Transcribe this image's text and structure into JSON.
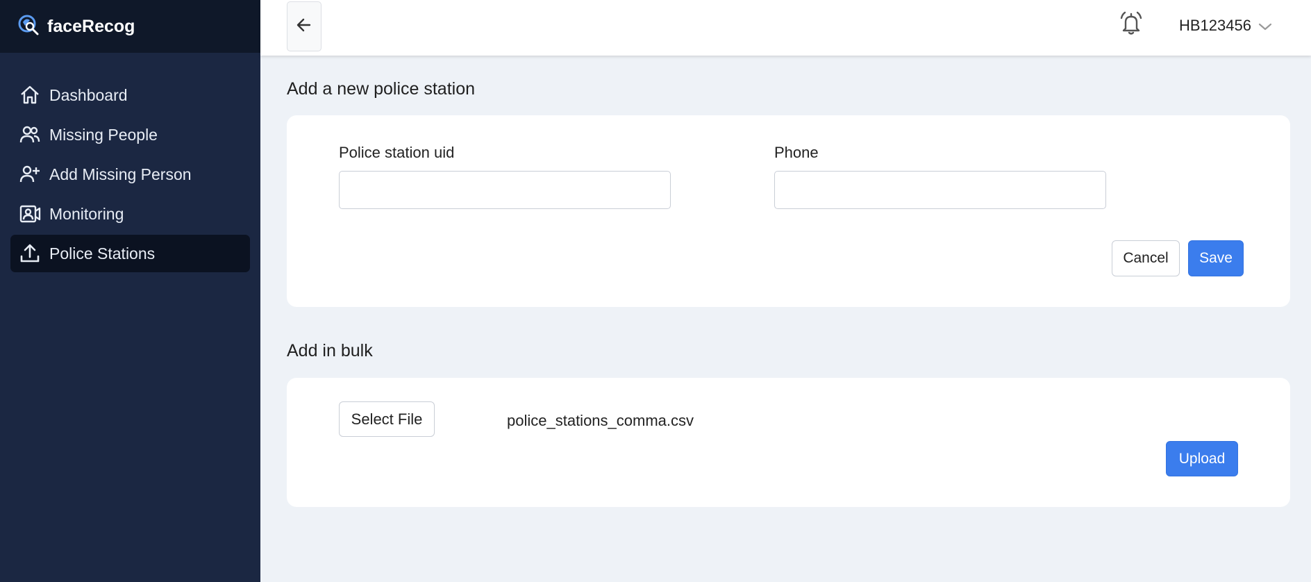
{
  "app": {
    "name": "faceRecog"
  },
  "sidebar": {
    "items": [
      {
        "label": "Dashboard",
        "icon": "home-icon"
      },
      {
        "label": "Missing People",
        "icon": "people-icon"
      },
      {
        "label": "Add Missing Person",
        "icon": "person-add-icon"
      },
      {
        "label": "Monitoring",
        "icon": "video-contact-icon"
      },
      {
        "label": "Police Stations",
        "icon": "upload-icon",
        "active": true
      }
    ]
  },
  "header": {
    "user_id": "HB123456"
  },
  "new_station": {
    "title": "Add a new police station",
    "uid_label": "Police station uid",
    "uid_value": "",
    "phone_label": "Phone",
    "phone_value": "",
    "cancel_label": "Cancel",
    "save_label": "Save"
  },
  "bulk": {
    "title": "Add in bulk",
    "select_label": "Select File",
    "filename": "police_stations_comma.csv",
    "upload_label": "Upload"
  },
  "colors": {
    "sidebar_bg": "#1b2742",
    "brand_bg": "#0f1829",
    "active_item_bg": "#0b1221",
    "primary": "#3b7ded",
    "page_bg": "#eef2f7"
  }
}
